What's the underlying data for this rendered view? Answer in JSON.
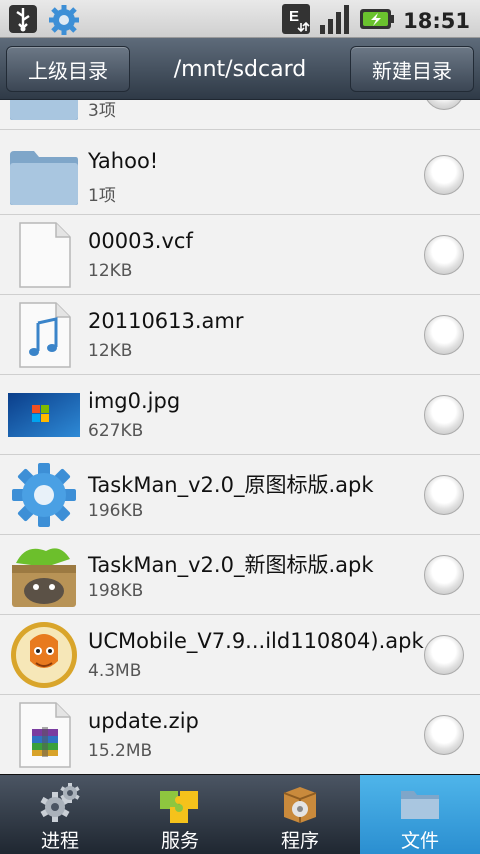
{
  "status": {
    "time": "18:51"
  },
  "title_bar": {
    "up_button": "上级目录",
    "path": "/mnt/sdcard",
    "new_dir_button": "新建目录"
  },
  "files": [
    {
      "name": "",
      "size": "3项",
      "icon": "folder-icon"
    },
    {
      "name": "Yahoo!",
      "size": "1项",
      "icon": "folder-icon"
    },
    {
      "name": "00003.vcf",
      "size": "12KB",
      "icon": "document-icon"
    },
    {
      "name": "20110613.amr",
      "size": "12KB",
      "icon": "music-note-icon"
    },
    {
      "name": "img0.jpg",
      "size": "627KB",
      "icon": "image-thumbnail-icon"
    },
    {
      "name": "TaskMan_v2.0_原图标版.apk",
      "size": "196KB",
      "icon": "gear-icon"
    },
    {
      "name": "TaskMan_v2.0_新图标版.apk",
      "size": "198KB",
      "icon": "totoro-box-icon"
    },
    {
      "name": "UCMobile_V7.9...ild110804).apk",
      "size": "4.3MB",
      "icon": "uc-squirrel-icon"
    },
    {
      "name": "update.zip",
      "size": "15.2MB",
      "icon": "zip-archive-icon"
    }
  ],
  "tabs": [
    {
      "label": "进程",
      "icon": "gears-icon"
    },
    {
      "label": "服务",
      "icon": "puzzle-icon"
    },
    {
      "label": "程序",
      "icon": "package-icon"
    },
    {
      "label": "文件",
      "icon": "folder-icon"
    }
  ],
  "colors": {
    "active_tab": "#3aa2df",
    "title_bar": "#3b4654"
  }
}
